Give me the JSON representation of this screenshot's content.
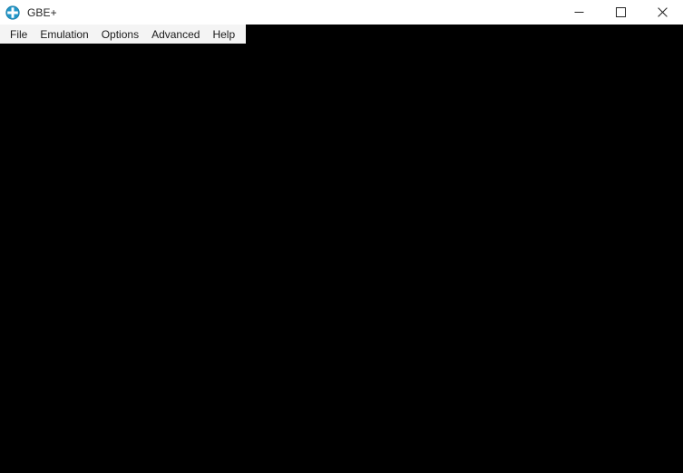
{
  "window": {
    "title": "GBE+",
    "icon": "gbe-plus-logo-icon",
    "accent_color": "#2196c9",
    "titlebar_bg": "#ffffff",
    "menubar_bg": "#f4f4f4",
    "display_bg": "#000000"
  },
  "window_controls": {
    "minimize": {
      "name": "minimize-button",
      "glyph": "—"
    },
    "maximize": {
      "name": "maximize-button",
      "glyph": "□"
    },
    "close": {
      "name": "close-button",
      "glyph": "✕"
    }
  },
  "menu": {
    "items": [
      {
        "label": "File"
      },
      {
        "label": "Emulation"
      },
      {
        "label": "Options"
      },
      {
        "label": "Advanced"
      },
      {
        "label": "Help"
      }
    ]
  },
  "display": {
    "content": ""
  }
}
